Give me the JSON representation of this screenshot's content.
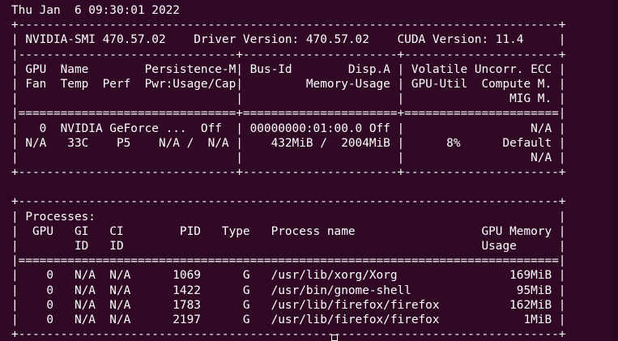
{
  "terminal": {
    "prompt": "          ",
    "timestamp": "Thu Jan  6 09:30:01 2022",
    "border_top": "+-----------------------------------------------------------------------------+",
    "version_row": "| NVIDIA-SMI 470.57.02    Driver Version: 470.57.02    CUDA Version: 11.4     |",
    "sep_dash": "|-------------------------------+----------------------+----------------------+",
    "header_row_1": "| GPU  Name        Persistence-M| Bus-Id        Disp.A | Volatile Uncorr. ECC |",
    "header_row_2": "| Fan  Temp  Perf  Pwr:Usage/Cap|         Memory-Usage | GPU-Util  Compute M. |",
    "header_row_3": "|                               |                      |               MIG M. |",
    "sep_equal": "|===============================+======================+======================|",
    "gpu_row_1": "|   0  NVIDIA GeForce ...  Off  | 00000000:01:00.0 Off |                  N/A |",
    "gpu_row_2": "| N/A   33C    P5    N/A /  N/A |    432MiB /  2004MiB |      8%      Default |",
    "gpu_row_3": "|                               |                      |                  N/A |",
    "border_gpu_bottom": "+-------------------------------+----------------------+----------------------+",
    "blank": " ",
    "proc_border_top": "+-----------------------------------------------------------------------------+",
    "proc_title": "| Processes:                                                                  |",
    "proc_header_1": "|  GPU   GI   CI        PID   Type   Process name                  GPU Memory |",
    "proc_header_2": "|        ID   ID                                                   Usage      |",
    "proc_sep": "|=============================================================================|",
    "processes": [
      "|    0   N/A  N/A      1069      G   /usr/lib/xorg/Xorg                169MiB |",
      "|    0   N/A  N/A      1422      G   /usr/bin/gnome-shell               95MiB |",
      "|    0   N/A  N/A      1783      G   /usr/lib/firefox/firefox          162MiB |",
      "|    0   N/A  N/A      2197      G   /usr/lib/firefox/firefox            1MiB |"
    ],
    "proc_border_bottom": "+-----------------------------------------------------------------------------+"
  },
  "colors": {
    "background": "#300a24",
    "foreground": "#ffffff",
    "prompt_green": "#8ae234"
  }
}
